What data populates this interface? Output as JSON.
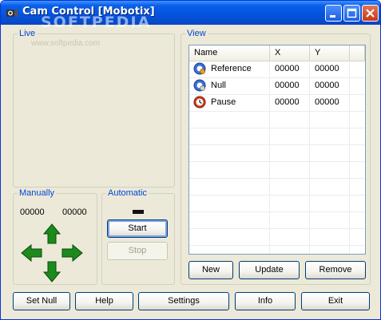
{
  "window": {
    "title": "Cam Control [Mobotix]",
    "watermark": "SOFTPEDIA",
    "controls": [
      "minimize",
      "maximize",
      "close"
    ]
  },
  "live": {
    "label": "Live",
    "watermark": "www.softpedia.com"
  },
  "manually": {
    "label": "Manually",
    "x_value": "00000",
    "y_value": "00000",
    "arrows": [
      "up-arrow-icon",
      "left-arrow-icon",
      "right-arrow-icon",
      "down-arrow-icon"
    ],
    "arrow_color": "#1c8a1c"
  },
  "automatic": {
    "label": "Automatic",
    "start_label": "Start",
    "stop_label": "Stop"
  },
  "view": {
    "label": "View",
    "columns": [
      "Name",
      "X",
      "Y"
    ],
    "rows": [
      {
        "icon": "reference-icon",
        "name": "Reference",
        "x": "00000",
        "y": "00000"
      },
      {
        "icon": "null-icon",
        "name": "Null",
        "x": "00000",
        "y": "00000"
      },
      {
        "icon": "pause-icon",
        "name": "Pause",
        "x": "00000",
        "y": "00000"
      }
    ],
    "new_label": "New",
    "update_label": "Update",
    "remove_label": "Remove"
  },
  "bottom_bar": {
    "set_null": "Set Null",
    "help": "Help",
    "settings": "Settings",
    "info": "Info",
    "exit": "Exit"
  },
  "colors": {
    "title_blue": "#0553dd",
    "group_label": "#0046d5",
    "window_bg": "#ece9d8",
    "close_red": "#c33a18"
  }
}
